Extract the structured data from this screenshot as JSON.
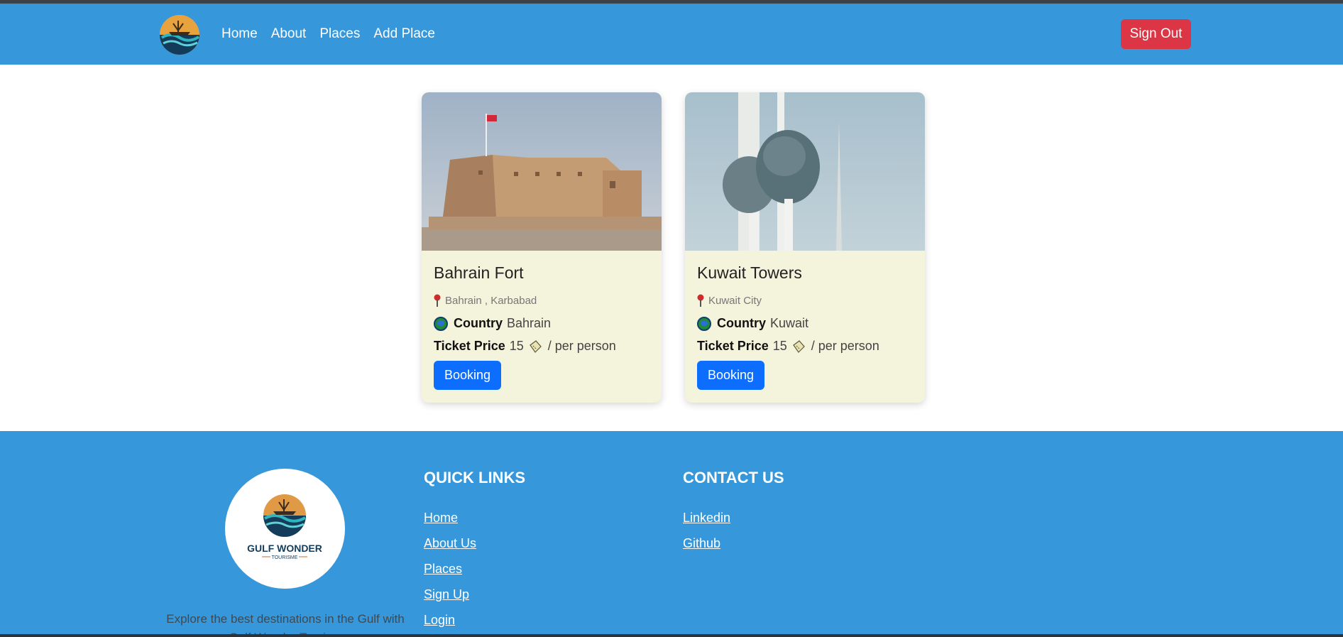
{
  "nav": {
    "logo_icon": "ship-logo",
    "links": [
      "Home",
      "About",
      "Places",
      "Add Place"
    ],
    "signout_label": "Sign Out"
  },
  "places": [
    {
      "name": "Bahrain Fort",
      "location": "Bahrain , Karbabad",
      "country_label": "Country",
      "country": "Bahrain",
      "price_label": "Ticket Price",
      "price": "15",
      "price_suffix": "/ per person",
      "button": "Booking",
      "image": "fort-photo"
    },
    {
      "name": "Kuwait Towers",
      "location": "Kuwait City",
      "country_label": "Country",
      "country": "Kuwait",
      "price_label": "Ticket Price",
      "price": "15",
      "price_suffix": "/ per person",
      "button": "Booking",
      "image": "towers-photo"
    }
  ],
  "footer": {
    "logo_text": "GULF WONDER",
    "logo_subtext": "TOURISME",
    "description": "Explore the best destinations in the Gulf with Gulf Wonder Tourism",
    "quick_links_heading": "QUICK LINKS",
    "quick_links": [
      "Home",
      "About Us",
      "Places",
      "Sign Up",
      "Login"
    ],
    "contact_heading": "CONTACT US",
    "contact_links": [
      "Linkedin",
      "Github"
    ]
  },
  "colors": {
    "primary_blue": "#3797db",
    "danger_red": "#dc3545",
    "button_blue": "#0d6efd",
    "card_bg": "#f4f3dc"
  }
}
